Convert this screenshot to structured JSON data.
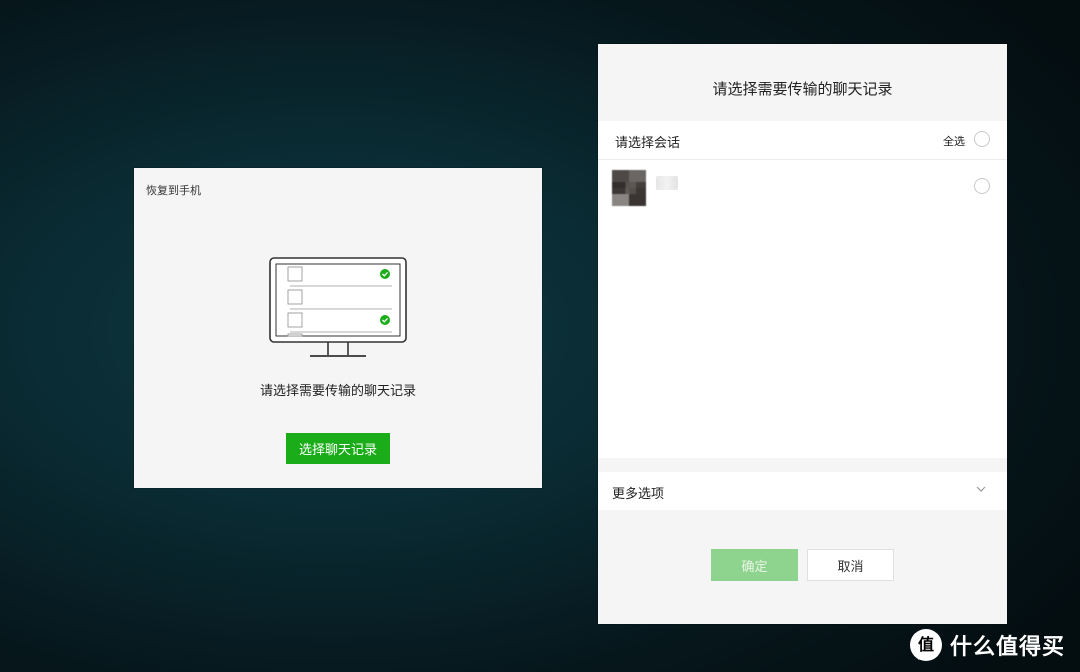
{
  "restore_dialog": {
    "title": "恢复到手机",
    "prompt": "请选择需要传输的聊天记录",
    "select_button_label": "选择聊天记录",
    "illustration_icon": "monitor-checklist-icon",
    "accent_color": "#1aad19"
  },
  "select_dialog": {
    "title": "请选择需要传输的聊天记录",
    "session_header_label": "请选择会话",
    "select_all_label": "全选",
    "contacts": [
      {
        "name": "",
        "avatar": "blurred-avatar",
        "selected": false
      }
    ],
    "more_options_label": "更多选项",
    "confirm_label": "确定",
    "cancel_label": "取消",
    "confirm_color": "#8fd48e"
  },
  "watermark": {
    "text": "什么值得买",
    "logo_char": "值"
  }
}
